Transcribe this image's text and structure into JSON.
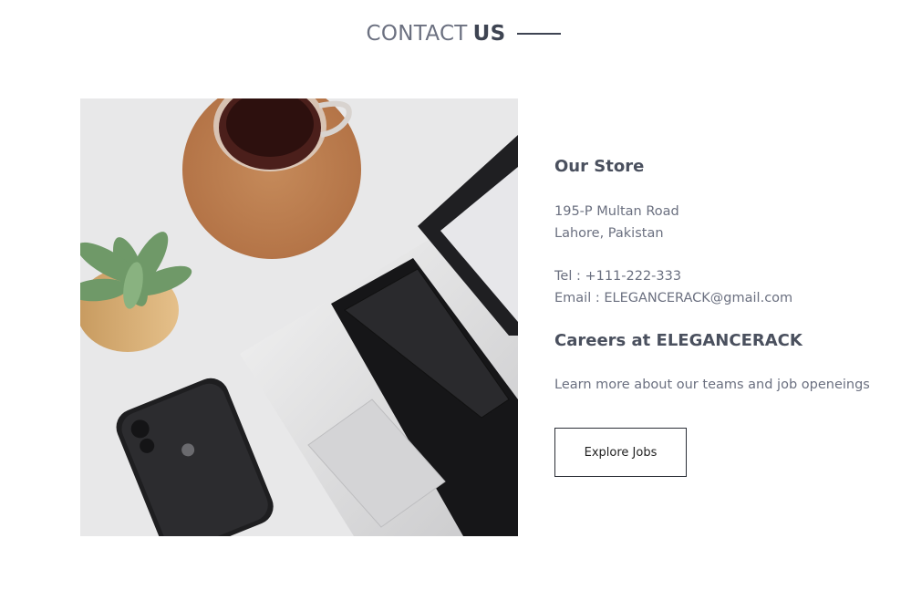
{
  "header": {
    "title_light": "CONTACT",
    "title_bold": "US"
  },
  "image": {
    "alt": "Desk with laptop, coffee, succulent and phone"
  },
  "store": {
    "title": "Our Store",
    "address_line1": "195-P Multan Road",
    "address_line2": "Lahore, Pakistan",
    "tel": "Tel : +111-222-333",
    "email": "Email : ELEGANCERACK@gmail.com"
  },
  "careers": {
    "title": "Careers at ELEGANCERACK",
    "text": "Learn more about our teams and job openeings",
    "button_label": "Explore Jobs"
  }
}
